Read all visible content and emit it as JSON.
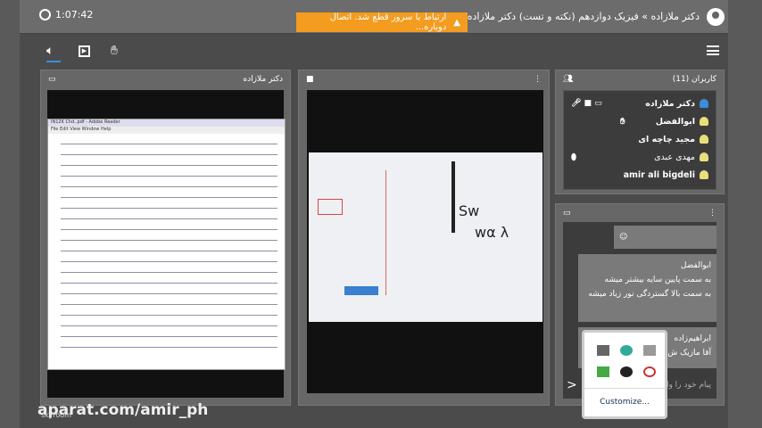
{
  "header": {
    "timer": "1:07:42",
    "warning": "ارتباط با سرور قطع شد. اتصال دوباره...",
    "title": "دکتر ملازاده » فیزیک دوازدهم (نکته و تست) دکتر ملازاده"
  },
  "toolbar": {
    "icons": [
      "speaker-icon",
      "presentation-icon",
      "raise-hand-icon",
      "menu-icon"
    ]
  },
  "screen_panel": {
    "title": "دکتر ملازاده",
    "doc_title": "IN12K Chd..pdf - Adobe Reader",
    "doc_menu": "File  Edit  View  Window  Help"
  },
  "users_panel": {
    "title": "کاربران (11)",
    "users": [
      {
        "name": "دکتر ملازاده",
        "color": "#3a8de0"
      },
      {
        "name": "ابوالفضل",
        "color": "#e8e07a"
      },
      {
        "name": "مجید چاچه ای",
        "color": "#e8e07a"
      },
      {
        "name": "مهدی عبدی",
        "color": "#e8e07a"
      },
      {
        "name": "amir ali bigdeli",
        "color": "#e8e07a"
      }
    ]
  },
  "chat": {
    "messages": [
      {
        "sender": "ابوالفضل",
        "lines": [
          "به سمت پایین سایه بیشتر میشه",
          "به سمت بالا گسترد‌گی نور زیاد میشه"
        ]
      },
      {
        "sender": "ابراهیم‌زاده",
        "lines": [
          "آقا مازیک ش..."
        ]
      }
    ],
    "placeholder": "پیام خود را وارد..."
  },
  "tray": {
    "customize": "Customize..."
  },
  "watermark": {
    "text": "aparat.com/amir_ph",
    "brand": "skyroom"
  },
  "colors": {
    "warning": "#f39c1f",
    "accent": "#3a8de0"
  }
}
